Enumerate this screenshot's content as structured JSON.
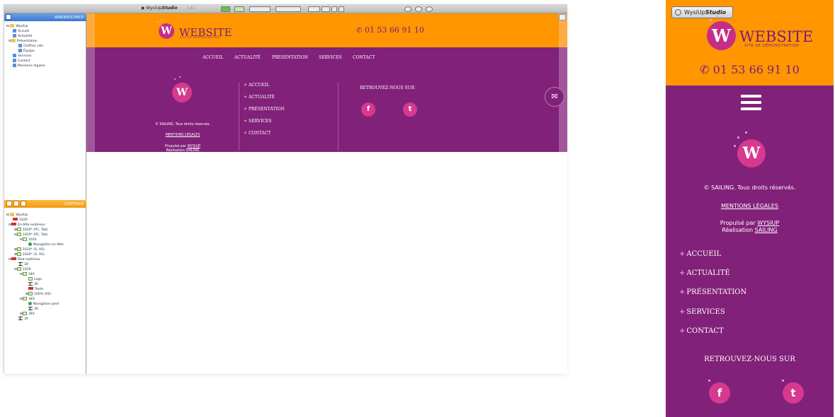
{
  "app": {
    "brand_prefix": "WysiUp",
    "brand_suffix": "Studio",
    "version": "1.8.1"
  },
  "panels": {
    "tree_title": "ARBORESCENCE",
    "content_title": "CONTENUS"
  },
  "site_tree": [
    {
      "label": "WysiUp"
    },
    {
      "label": "Accueil"
    },
    {
      "label": "Actualité"
    },
    {
      "label": "Présentation"
    },
    {
      "label": "Chiffres clés"
    },
    {
      "label": "Équipe"
    },
    {
      "label": "Services"
    },
    {
      "label": "Contact"
    },
    {
      "label": "Mentions légales"
    }
  ],
  "content_tree": [
    {
      "label": "WysiUp"
    },
    {
      "label": "1020"
    },
    {
      "label": "En-tête extérieur"
    },
    {
      "label": "1020* (PC, Tab)"
    },
    {
      "label": "1020* (PC, Tab)"
    },
    {
      "label": "1020"
    },
    {
      "label": "Navigation en-tête"
    },
    {
      "label": "1020* (S, XS)"
    },
    {
      "label": "1020* (S, XS)"
    },
    {
      "label": "Pied extérieur"
    },
    {
      "label": "30"
    },
    {
      "label": "1020"
    },
    {
      "label": "340"
    },
    {
      "label": "Logo"
    },
    {
      "label": "30"
    },
    {
      "label": "Texte"
    },
    {
      "label": "100% (XS)"
    },
    {
      "label": "340"
    },
    {
      "label": "Navigation pied"
    },
    {
      "label": "30"
    },
    {
      "label": "340"
    },
    {
      "label": "30"
    }
  ],
  "site": {
    "logo_letter": "W",
    "name": "WEBSITE",
    "tagline": "SITE DE DÉMONSTRATION",
    "phone": "01 53 66 91 10",
    "nav": [
      "ACCUEIL",
      "ACTUALITÉ",
      "PRÉSENTATION",
      "SERVICES",
      "CONTACT"
    ],
    "footer_links": [
      "ACCUEIL",
      "ACTUALITÉ",
      "PRÉSENTATION",
      "SERVICES",
      "CONTACT"
    ],
    "copyright": "© SAILING. Tous droits réservés.",
    "legal": "MENTIONS LÉGALES",
    "powered_prefix": "Propulsé par",
    "powered_link": "WYSIUP",
    "realisation_prefix": "Réalisation",
    "realisation_link": "SAILING",
    "follow": "RETROUVEZ-NOUS SUR",
    "plus": "+",
    "facebook": "f",
    "twitter": "t"
  },
  "colors": {
    "orange": "#ff9600",
    "purple": "#822179",
    "pink": "#d6398f"
  }
}
